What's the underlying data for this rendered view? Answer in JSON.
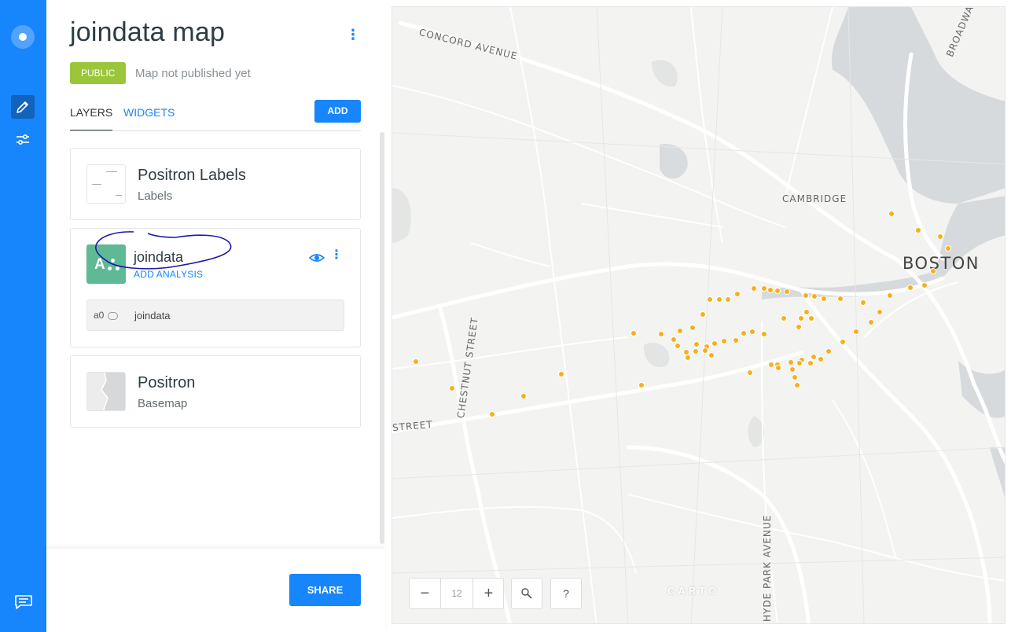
{
  "header": {
    "map_title": "joindata map",
    "visibility_badge": "PUBLIC",
    "publish_status": "Map not published yet"
  },
  "tabs": [
    {
      "label": "LAYERS",
      "active": true
    },
    {
      "label": "WIDGETS",
      "active": false
    }
  ],
  "add_button": "ADD",
  "layers": [
    {
      "title": "Positron Labels",
      "subtitle": "Labels",
      "icon": "labels-thumbnail"
    },
    {
      "title": "joindata",
      "action": "ADD ANALYSIS",
      "thumb_letter": "A",
      "analysis": {
        "id": "a0",
        "name": "joindata"
      },
      "icon": "point-layer-thumbnail"
    },
    {
      "title": "Positron",
      "subtitle": "Basemap",
      "icon": "basemap-thumbnail"
    }
  ],
  "footer": {
    "share_label": "SHARE"
  },
  "map": {
    "labels": {
      "concord": "CONCORD AVENUE",
      "broadway": "BROADWAY",
      "cambridge": "CAMBRIDGE",
      "boston": "BOSTON",
      "chestnut": "CHESTNUT STREET",
      "street": "STREET",
      "hyde": "HYDE PARK AVENUE"
    },
    "attribution": "CARTO",
    "zoom": {
      "minus": "−",
      "level": "12",
      "plus": "+"
    },
    "help": "?",
    "point_color": "#f6b01e"
  },
  "colors": {
    "brand": "#1785fb",
    "public_badge": "#9bc63b",
    "layer_thumb": "#5fb994"
  }
}
